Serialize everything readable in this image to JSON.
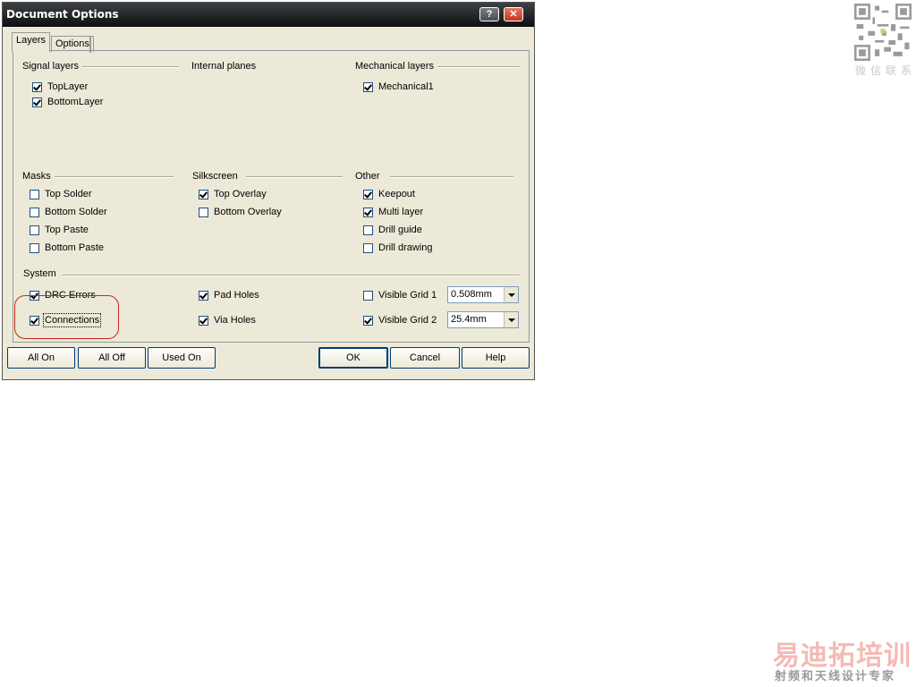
{
  "window": {
    "title": "Document Options"
  },
  "tabs": [
    {
      "label": "Layers"
    },
    {
      "label": "Options"
    }
  ],
  "groups": {
    "signal": {
      "label": "Signal layers",
      "items": [
        {
          "label": "TopLayer",
          "checked": true
        },
        {
          "label": "BottomLayer",
          "checked": true
        }
      ]
    },
    "internal": {
      "label": "Internal planes"
    },
    "mechanical": {
      "label": "Mechanical layers",
      "items": [
        {
          "label": "Mechanical1",
          "checked": true
        }
      ]
    },
    "masks": {
      "label": "Masks",
      "items": [
        {
          "label": "Top Solder",
          "checked": false
        },
        {
          "label": "Bottom Solder",
          "checked": false
        },
        {
          "label": "Top Paste",
          "checked": false
        },
        {
          "label": "Bottom Paste",
          "checked": false
        }
      ]
    },
    "silkscreen": {
      "label": "Silkscreen",
      "items": [
        {
          "label": "Top Overlay",
          "checked": true
        },
        {
          "label": "Bottom Overlay",
          "checked": false
        }
      ]
    },
    "other": {
      "label": "Other",
      "items": [
        {
          "label": "Keepout",
          "checked": true
        },
        {
          "label": "Multi layer",
          "checked": true
        },
        {
          "label": "Drill guide",
          "checked": false
        },
        {
          "label": "Drill drawing",
          "checked": false
        }
      ]
    },
    "system": {
      "label": "System",
      "drc_errors": {
        "label": "DRC Errors",
        "checked": true
      },
      "connections": {
        "label": "Connections",
        "checked": true
      },
      "pad_holes": {
        "label": "Pad Holes",
        "checked": true
      },
      "via_holes": {
        "label": "Via Holes",
        "checked": true
      },
      "visible_grid_1": {
        "label": "Visible Grid 1",
        "checked": false,
        "value": "0.508mm"
      },
      "visible_grid_2": {
        "label": "Visible Grid 2",
        "checked": true,
        "value": "25.4mm"
      }
    }
  },
  "buttons": {
    "all_on": "All On",
    "all_off": "All Off",
    "used_on": "Used On",
    "ok": "OK",
    "cancel": "Cancel",
    "help": "Help"
  },
  "titlebar_buttons": {
    "help": "?",
    "close": "✕"
  },
  "watermark": {
    "qr_caption": "微信联系",
    "brand": "易迪拓培训",
    "tagline": "射频和天线设计专家"
  },
  "colors": {
    "highlight_circle": "#c8281e",
    "titlebar": "#0d0e10"
  }
}
